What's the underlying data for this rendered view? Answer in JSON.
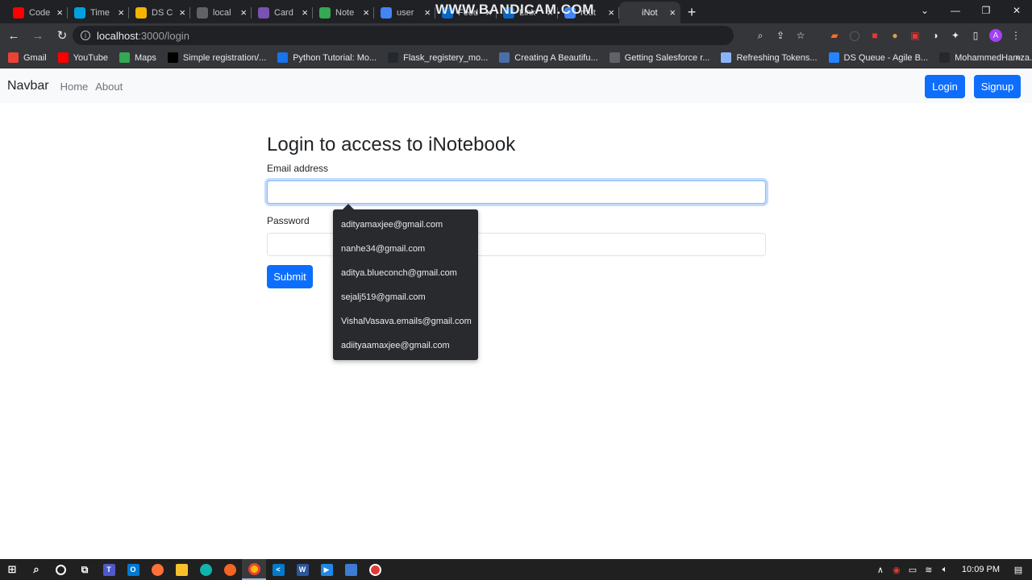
{
  "browser": {
    "tabs": [
      {
        "label": "Code",
        "icon": "youtube-icon",
        "color": "#ff0000"
      },
      {
        "label": "Time",
        "icon": "salesforce-icon",
        "color": "#00a1e0"
      },
      {
        "label": "DS C",
        "icon": "ds-icon",
        "color": "#f4b400"
      },
      {
        "label": "local",
        "icon": "globe-icon",
        "color": "#5f6368"
      },
      {
        "label": "Card",
        "icon": "bootstrap-icon",
        "color": "#7952b3"
      },
      {
        "label": "Note",
        "icon": "play-icon",
        "color": "#34a853"
      },
      {
        "label": "user",
        "icon": "google-icon",
        "color": "#4285f4"
      },
      {
        "label": "Feed",
        "icon": "linkedin-icon",
        "color": "#0a66c2"
      },
      {
        "label": "Link",
        "icon": "linkedin-icon",
        "color": "#0a66c2"
      },
      {
        "label": "rout",
        "icon": "google-icon",
        "color": "#4285f4"
      },
      {
        "label": "iNot",
        "icon": "react-icon",
        "color": "#35363a",
        "active": true
      }
    ],
    "watermark": "WWW.BANDICAM.COM",
    "url_host": "localhost",
    "url_path": ":3000/login",
    "bookmarks": [
      {
        "label": "Gmail",
        "icon": "gmail-icon",
        "color": "#ea4335"
      },
      {
        "label": "YouTube",
        "icon": "youtube-icon",
        "color": "#ff0000"
      },
      {
        "label": "Maps",
        "icon": "maps-icon",
        "color": "#34a853"
      },
      {
        "label": "Simple registration/...",
        "icon": "medium-icon",
        "color": "#000000"
      },
      {
        "label": "Python Tutorial: Mo...",
        "icon": "b-icon",
        "color": "#1a73e8"
      },
      {
        "label": "Flask_registery_mo...",
        "icon": "github-icon",
        "color": "#24292e"
      },
      {
        "label": "Creating A Beautifu...",
        "icon": "site-icon",
        "color": "#4a6ea9"
      },
      {
        "label": "Getting Salesforce r...",
        "icon": "globe-icon",
        "color": "#5f6368"
      },
      {
        "label": "Refreshing Tokens...",
        "icon": "doc-icon",
        "color": "#8ab4f8"
      },
      {
        "label": "DS Queue - Agile B...",
        "icon": "jira-icon",
        "color": "#2684ff"
      },
      {
        "label": "MohammedHamza...",
        "icon": "github-icon",
        "color": "#24292e"
      }
    ]
  },
  "page": {
    "navbar": {
      "brand": "Navbar",
      "links": [
        "Home",
        "About"
      ],
      "login": "Login",
      "signup": "Signup"
    },
    "heading": "Login to access to iNotebook",
    "email_label": "Email address",
    "email_value": "",
    "password_label": "Password",
    "password_value": "",
    "submit": "Submit",
    "autofill": [
      "adityamaxjee@gmail.com",
      "nanhe34@gmail.com",
      "aditya.blueconch@gmail.com",
      "sejalj519@gmail.com",
      "VishalVasava.emails@gmail.com",
      "adiityaamaxjee@gmail.com"
    ]
  },
  "taskbar": {
    "clock": "10:09 PM"
  },
  "colors": {
    "primary": "#0d6efd",
    "chrome_dark": "#202124",
    "chrome_toolbar": "#35363a",
    "navbar_bg": "#f8f9fa"
  }
}
